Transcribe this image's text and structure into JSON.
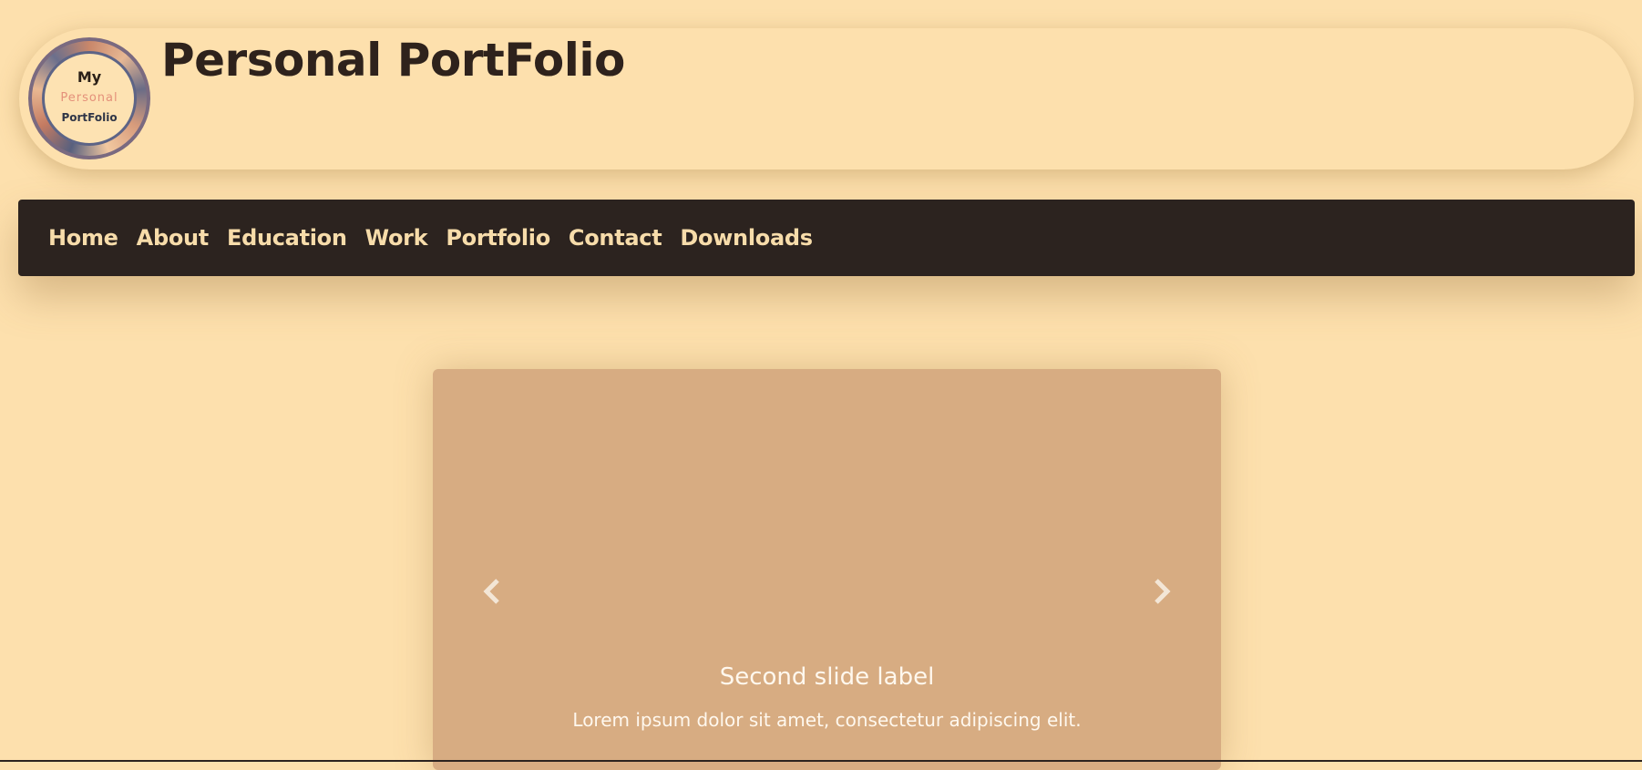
{
  "header": {
    "title": "Personal PortFolio",
    "logo": {
      "line1": "My",
      "line2": "Personal",
      "line3": "PortFolio"
    }
  },
  "nav": {
    "items": [
      "Home",
      "About",
      "Education",
      "Work",
      "Portfolio",
      "Contact",
      "Downloads"
    ]
  },
  "carousel": {
    "caption_title": "Second slide label",
    "caption_text": "Lorem ipsum dolor sit amet, consectetur adipiscing elit.",
    "prev_icon": "chevron-left-icon",
    "next_icon": "chevron-right-icon"
  },
  "colors": {
    "page_background": "#fde0ad",
    "navbar_background": "#2c231f",
    "nav_text": "#f7dcaa",
    "title_text": "#2e221c",
    "slide_background": "#d7ac82"
  }
}
